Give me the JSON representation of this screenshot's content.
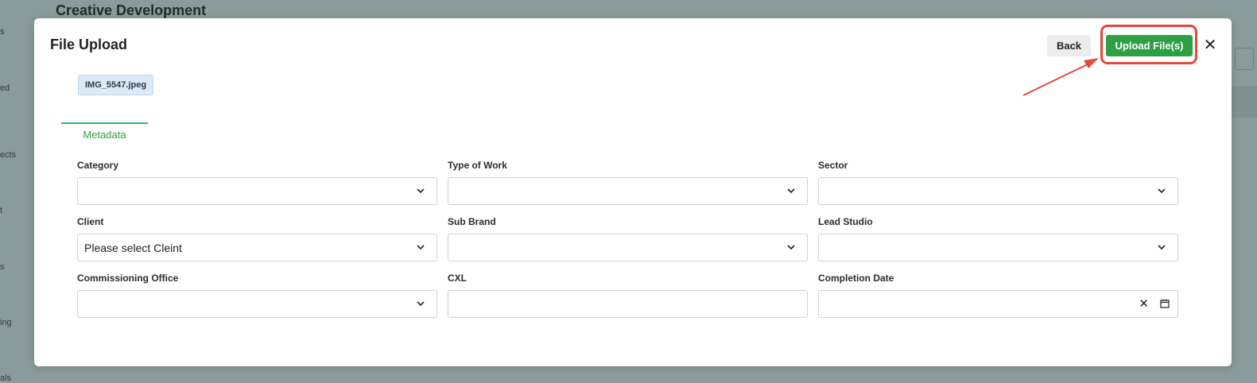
{
  "background": {
    "page_title": "Creative Development",
    "side_labels": [
      "s",
      "ed",
      "ects",
      "t",
      "s",
      "ing",
      "als"
    ]
  },
  "modal": {
    "title": "File Upload",
    "back_label": "Back",
    "upload_label": "Upload File(s)",
    "close_glyph": "✕",
    "file_chip": "IMG_5547.jpeg",
    "tab_label": "Metadata",
    "fields": {
      "category": {
        "label": "Category",
        "value": ""
      },
      "type_of_work": {
        "label": "Type of Work",
        "value": ""
      },
      "sector": {
        "label": "Sector",
        "value": ""
      },
      "client": {
        "label": "Client",
        "value": "Please select Cleint"
      },
      "sub_brand": {
        "label": "Sub Brand",
        "value": ""
      },
      "lead_studio": {
        "label": "Lead Studio",
        "value": ""
      },
      "commissioning_office": {
        "label": "Commissioning Office",
        "value": ""
      },
      "cxl": {
        "label": "CXL",
        "value": ""
      },
      "completion_date": {
        "label": "Completion Date",
        "value": ""
      }
    },
    "clear_glyph": "✕"
  },
  "colors": {
    "accent": "#2ea043",
    "annotation": "#e24a3b",
    "overlay": "#8a9b9b"
  },
  "icons": [
    "chevron-down-icon",
    "close-icon",
    "calendar-icon",
    "arrow-annotation"
  ]
}
